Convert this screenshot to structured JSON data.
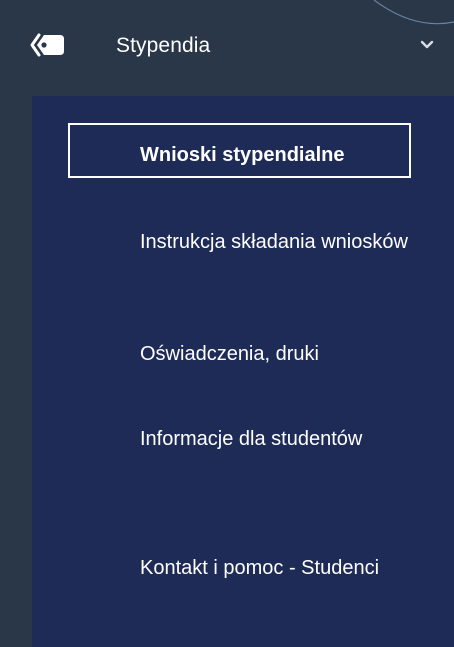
{
  "menu": {
    "section_title": "Stypendia",
    "section_icon": "tag-icon",
    "expand_icon": "chevron-down-icon",
    "items": [
      {
        "label": "Wnioski stypendialne",
        "active": true
      },
      {
        "label": "Instrukcja składania wniosków",
        "active": false
      },
      {
        "label": "Oświadczenia, druki",
        "active": false
      },
      {
        "label": "Informacje dla studentów",
        "active": false
      },
      {
        "label": "Kontakt i pomoc - Studenci",
        "active": false
      }
    ]
  },
  "colors": {
    "header_bg": "#2a3748",
    "submenu_bg": "#1f2b57",
    "text": "#ffffff"
  }
}
